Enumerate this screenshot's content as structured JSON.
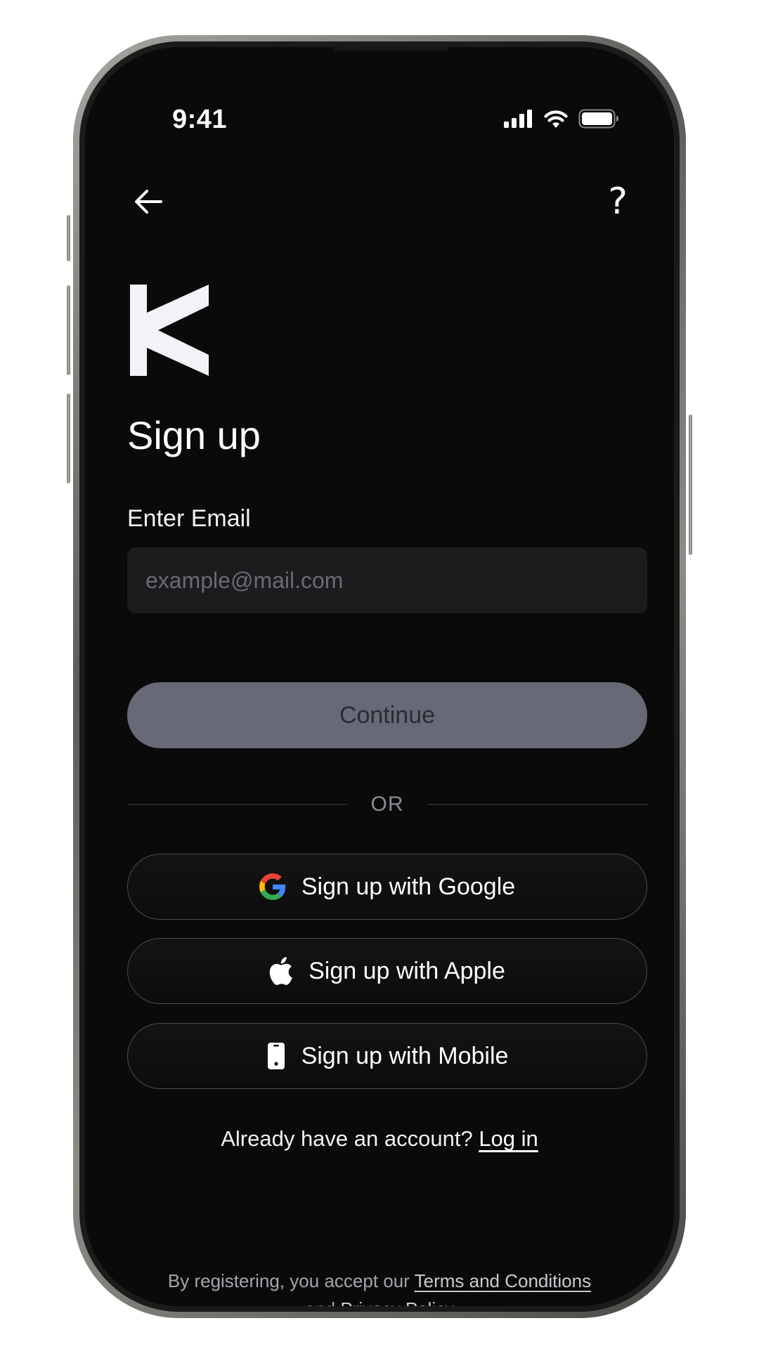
{
  "status_bar": {
    "time": "9:41"
  },
  "header": {
    "back_icon": "arrow-left-icon",
    "help_label": "?"
  },
  "brand": {
    "logo_icon": "k-logo-icon"
  },
  "page": {
    "title": "Sign up"
  },
  "email": {
    "label": "Enter Email",
    "placeholder": "example@mail.com",
    "value": ""
  },
  "continue": {
    "label": "Continue"
  },
  "divider": {
    "label": "OR"
  },
  "social": [
    {
      "label": "Sign up with Google",
      "icon": "google-icon"
    },
    {
      "label": "Sign up with Apple",
      "icon": "apple-icon"
    },
    {
      "label": "Sign up with Mobile",
      "icon": "mobile-icon"
    }
  ],
  "login": {
    "prompt": "Already have an account?",
    "link": "Log in"
  },
  "legal": {
    "prefix": "By registering, you accept our",
    "terms": "Terms and Conditions",
    "and": "and",
    "privacy": "Privacy Policy"
  },
  "colors": {
    "background": "#0a0a0a",
    "input_bg": "#1c1c1e",
    "button_disabled": "#676977",
    "text_muted": "#a3a5ad"
  }
}
